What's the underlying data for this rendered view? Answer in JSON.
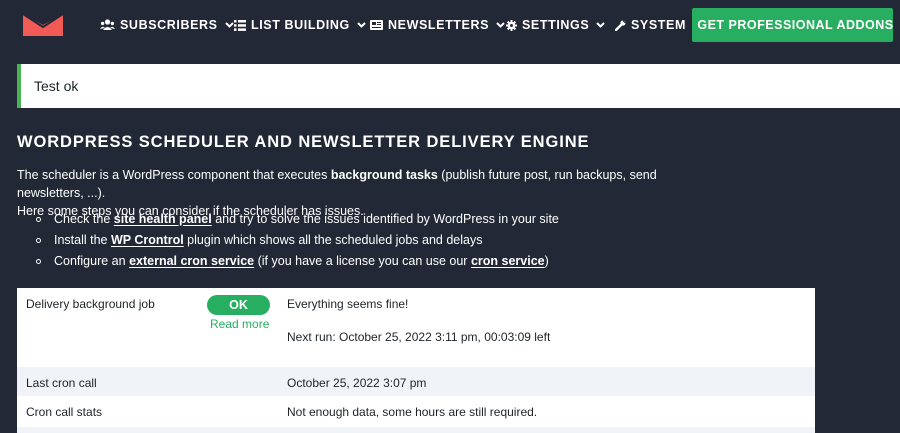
{
  "nav": {
    "items": [
      {
        "label": "Subscribers",
        "icon": "users-icon"
      },
      {
        "label": "List Building",
        "icon": "list-icon"
      },
      {
        "label": "Newsletters",
        "icon": "newspaper-icon"
      },
      {
        "label": "Settings",
        "icon": "gear-icon"
      },
      {
        "label": "System",
        "icon": "wrench-icon"
      }
    ],
    "cta_label": "Get Professional Addons",
    "cta_color": "#27ae60"
  },
  "notice": {
    "text": "Test ok",
    "color": "#46b450"
  },
  "page": {
    "title": "WordPress Scheduler and Newsletter Delivery Engine",
    "intro_1": "The scheduler is a WordPress component that executes ",
    "intro_bold": "background tasks",
    "intro_2": " (publish future post, run backups, send newsletters, ...).",
    "intro_3": "Here some steps you can consider if the scheduler has issues."
  },
  "bullets": [
    {
      "pre": "Check the ",
      "link": "site health panel",
      "post": " and try to solve the issues identified by WordPress in your site"
    },
    {
      "pre": "Install the ",
      "link": "WP Crontrol",
      "post": " plugin which shows all the scheduled jobs and delays"
    },
    {
      "pre": "Configure an ",
      "link": "external cron service",
      "mid": " (if you have a license you can use our ",
      "link2": "cron service",
      "post": ")"
    }
  ],
  "status": {
    "rows": [
      {
        "label": "Delivery background job",
        "badge": "OK",
        "read_more": "Read more",
        "value": "Everything seems fine!",
        "value_2": "Next run: October 25, 2022 3:11 pm, 00:03:09 left"
      },
      {
        "label": "Last cron call",
        "value": "October 25, 2022 3:07 pm"
      },
      {
        "label": "Cron call stats",
        "value": "Not enough data, some hours are still required."
      }
    ]
  }
}
